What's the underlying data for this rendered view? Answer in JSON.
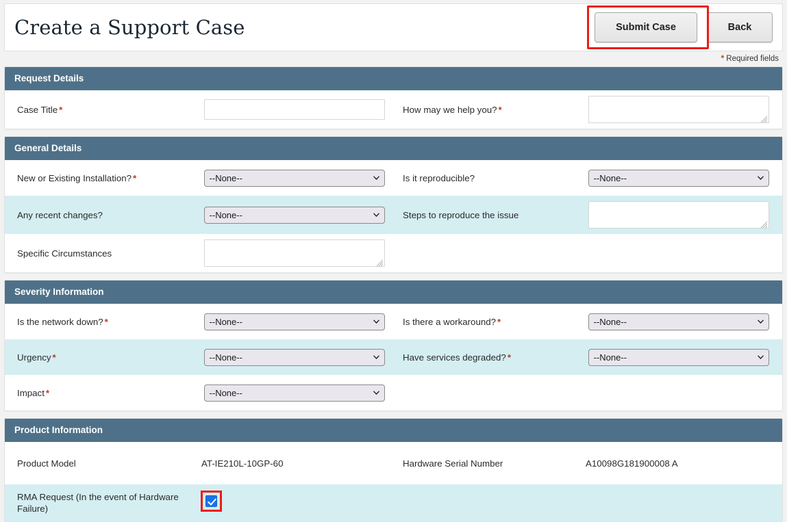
{
  "header": {
    "title": "Create a Support Case",
    "submit_label": "Submit Case",
    "back_label": "Back",
    "required_star": "*",
    "required_note": "Required fields"
  },
  "colors": {
    "section_header": "#4e7189",
    "alt_row": "#d4eef2",
    "required_star": "#c0392b",
    "annotation": "#ee1b15",
    "checkbox_checked": "#1a73e8",
    "page_background": "#f2f2f2"
  },
  "select_none": "--None--",
  "sections": [
    {
      "title": "Request Details",
      "rows": [
        {
          "alt": false,
          "left": {
            "label": "Case Title",
            "required": true,
            "control": "text"
          },
          "right": {
            "label": "How may we help you?",
            "required": true,
            "control": "textarea"
          }
        }
      ]
    },
    {
      "title": "General Details",
      "rows": [
        {
          "alt": false,
          "left": {
            "label": "New or Existing Installation?",
            "required": true,
            "control": "select",
            "value": "--None--"
          },
          "right": {
            "label": "Is it reproducible?",
            "required": false,
            "control": "select",
            "value": "--None--"
          }
        },
        {
          "alt": true,
          "left": {
            "label": "Any recent changes?",
            "required": false,
            "control": "select",
            "value": "--None--"
          },
          "right": {
            "label": "Steps to reproduce the issue",
            "required": false,
            "control": "textarea"
          }
        },
        {
          "alt": false,
          "left": {
            "label": "Specific Circumstances",
            "required": false,
            "control": "textarea"
          },
          "right": {
            "label": "",
            "required": false,
            "control": "none"
          }
        }
      ]
    },
    {
      "title": "Severity Information",
      "rows": [
        {
          "alt": false,
          "left": {
            "label": "Is the network down?",
            "required": true,
            "control": "select",
            "value": "--None--"
          },
          "right": {
            "label": "Is there a workaround?",
            "required": true,
            "control": "select",
            "value": "--None--"
          }
        },
        {
          "alt": true,
          "left": {
            "label": "Urgency",
            "required": true,
            "control": "select",
            "value": "--None--"
          },
          "right": {
            "label": "Have services degraded?",
            "required": true,
            "control": "select",
            "value": "--None--"
          }
        },
        {
          "alt": false,
          "left": {
            "label": "Impact",
            "required": true,
            "control": "select",
            "value": "--None--"
          },
          "right": {
            "label": "",
            "required": false,
            "control": "none"
          }
        }
      ]
    },
    {
      "title": "Product Information",
      "rows": [
        {
          "alt": false,
          "left": {
            "label": "Product Model",
            "required": false,
            "control": "readonly",
            "value": "AT-IE210L-10GP-60"
          },
          "right": {
            "label": "Hardware Serial Number",
            "required": false,
            "control": "readonly",
            "value": "A10098G181900008 A"
          }
        },
        {
          "alt": true,
          "left": {
            "label": "RMA Request (In the event of Hardware Failure)",
            "required": false,
            "control": "checkbox",
            "checked": true
          },
          "right": {
            "label": "",
            "required": false,
            "control": "none"
          }
        }
      ]
    }
  ]
}
